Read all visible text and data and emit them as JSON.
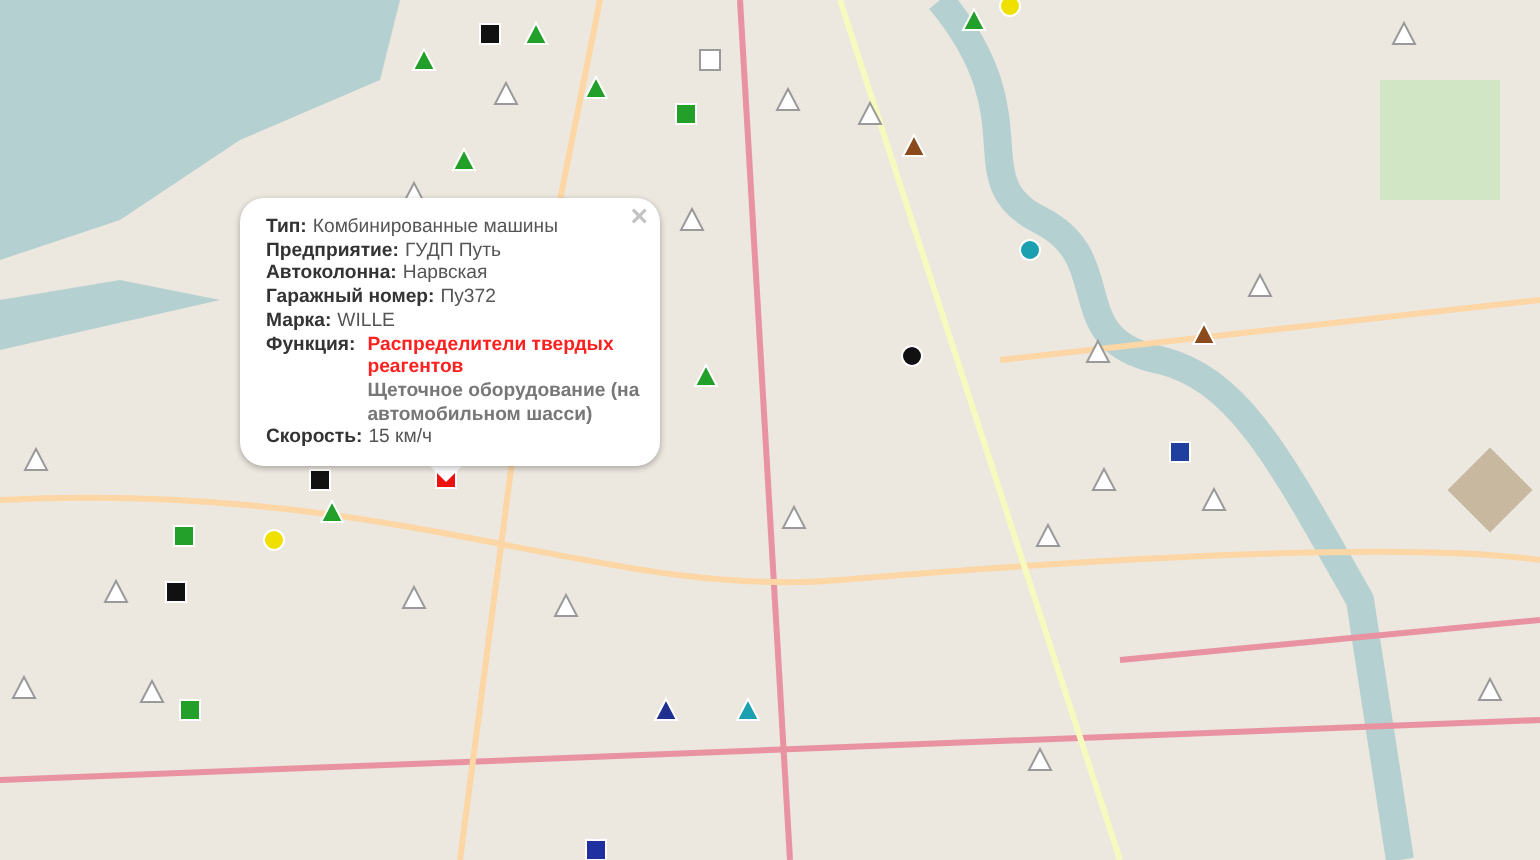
{
  "map": {
    "markers": [
      {
        "kind": "square",
        "color": "#111111"
      },
      {
        "kind": "triangle",
        "color": "#22a02a"
      },
      {
        "kind": "triangle",
        "color": "#22a02a"
      },
      {
        "kind": "triangle",
        "color": "#ffffff"
      },
      {
        "kind": "triangle",
        "color": "#22a02a"
      },
      {
        "kind": "square",
        "color": "#22a02a"
      },
      {
        "kind": "square",
        "color": "#ffffff"
      },
      {
        "kind": "triangle",
        "color": "#ffffff"
      },
      {
        "kind": "triangle",
        "color": "#ffffff"
      },
      {
        "kind": "triangle",
        "color": "#8b4a1c"
      },
      {
        "kind": "triangle",
        "color": "#22a02a"
      },
      {
        "kind": "triangle",
        "color": "#ffffff"
      },
      {
        "kind": "triangle",
        "color": "#ffffff"
      },
      {
        "kind": "circle",
        "color": "#1aa0b0"
      },
      {
        "kind": "triangle",
        "color": "#ffffff"
      },
      {
        "kind": "triangle",
        "color": "#8b4a1c"
      },
      {
        "kind": "circle",
        "color": "#111111"
      },
      {
        "kind": "triangle",
        "color": "#ffffff"
      },
      {
        "kind": "triangle",
        "color": "#22a02a"
      },
      {
        "kind": "square",
        "color": "#ee1111"
      },
      {
        "kind": "square",
        "color": "#111111"
      },
      {
        "kind": "triangle",
        "color": "#22a02a"
      },
      {
        "kind": "circle",
        "color": "#f0e000"
      },
      {
        "kind": "square",
        "color": "#22a02a"
      },
      {
        "kind": "triangle",
        "color": "#ffffff"
      },
      {
        "kind": "square",
        "color": "#111111"
      },
      {
        "kind": "triangle",
        "color": "#ffffff"
      },
      {
        "kind": "triangle",
        "color": "#ffffff"
      },
      {
        "kind": "triangle",
        "color": "#ffffff"
      },
      {
        "kind": "triangle",
        "color": "#ffffff"
      },
      {
        "kind": "triangle",
        "color": "#ffffff"
      },
      {
        "kind": "square",
        "color": "#2040a0"
      },
      {
        "kind": "triangle",
        "color": "#ffffff"
      },
      {
        "kind": "triangle",
        "color": "#203090"
      },
      {
        "kind": "triangle",
        "color": "#1aa0b0"
      },
      {
        "kind": "triangle",
        "color": "#ffffff"
      },
      {
        "kind": "triangle",
        "color": "#ffffff"
      },
      {
        "kind": "circle",
        "color": "#f0e000"
      },
      {
        "kind": "triangle",
        "color": "#22a02a"
      },
      {
        "kind": "triangle",
        "color": "#ffffff"
      },
      {
        "kind": "square",
        "color": "#2030a0"
      },
      {
        "kind": "triangle",
        "color": "#ffffff"
      },
      {
        "kind": "square",
        "color": "#22a02a"
      },
      {
        "kind": "triangle",
        "color": "#ffffff"
      },
      {
        "kind": "triangle",
        "color": "#ffffff"
      }
    ]
  },
  "popup": {
    "close": "×",
    "fields": [
      {
        "label": "Тип:",
        "value": "Комбинированные машины"
      },
      {
        "label": "Предприятие:",
        "value": "ГУДП Путь"
      },
      {
        "label": "Автоколонна:",
        "value": "Нарвская"
      },
      {
        "label": "Гаражный номер:",
        "value": "Пу372"
      },
      {
        "label": "Марка:",
        "value": "WILLE"
      }
    ],
    "function": {
      "label": "Функция:",
      "items": [
        {
          "text": "Распределители твердых реагентов",
          "color": "#ff2020"
        },
        {
          "text": "Щеточное оборудование (на автомобильном шасси)",
          "color": "#777777"
        }
      ]
    },
    "speed": {
      "label": "Скорость:",
      "value": "15 км/ч"
    }
  }
}
